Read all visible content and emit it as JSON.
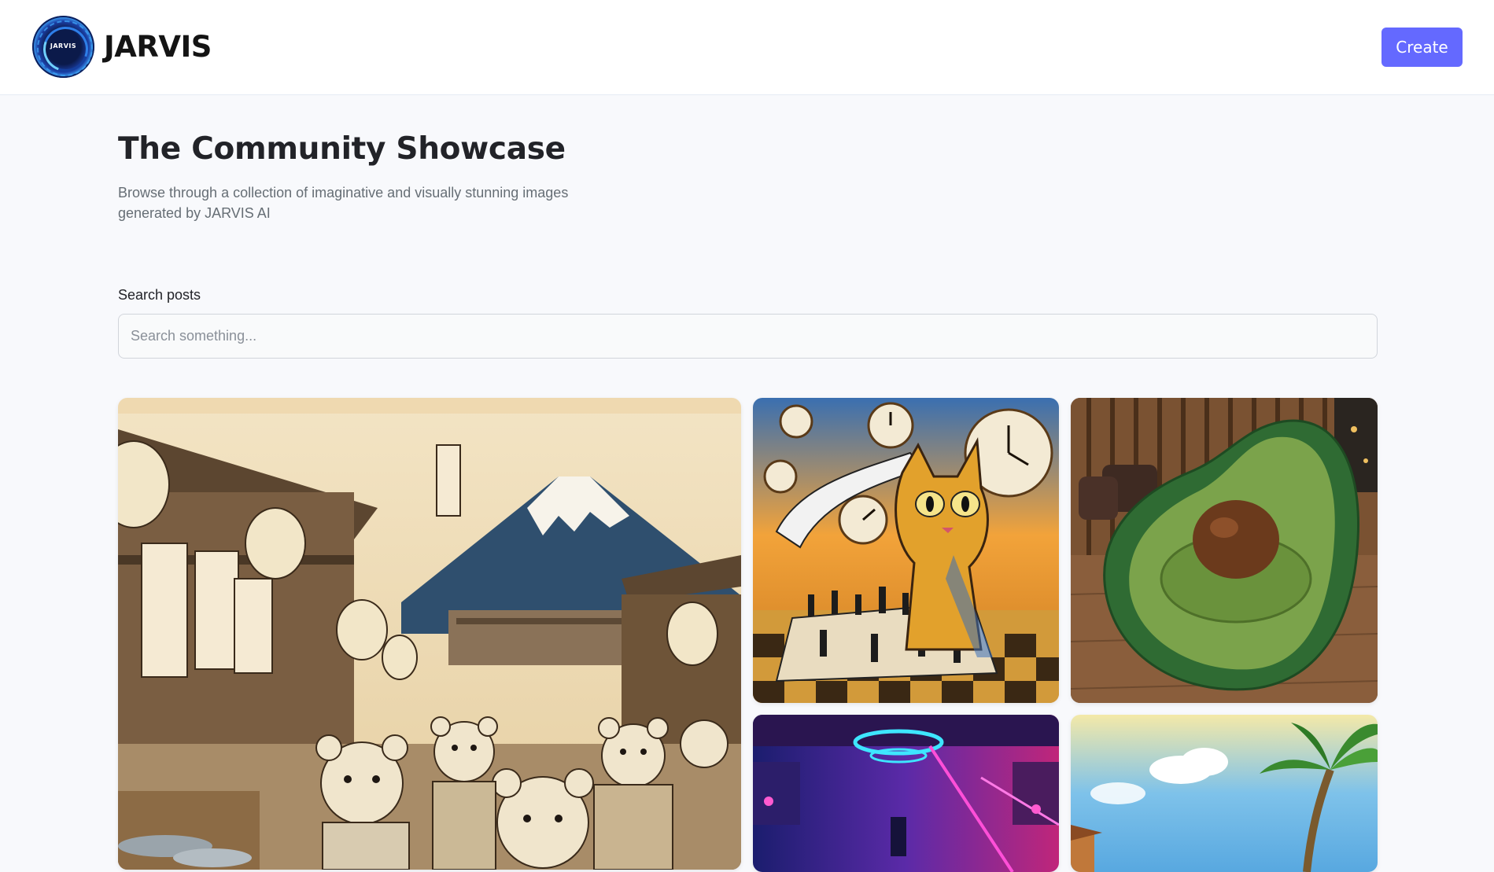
{
  "header": {
    "logo_badge_text": "JARVIS",
    "brand_name": "JARVIS",
    "create_label": "Create"
  },
  "main": {
    "title": "The Community Showcase",
    "subtitle": "Browse through a collection of imaginative and visually stunning images generated by JARVIS AI"
  },
  "search": {
    "label": "Search posts",
    "placeholder": "Search something...",
    "value": ""
  },
  "gallery": {
    "cards": [
      {
        "subject": "ukiyo-e bears market mount fuji"
      },
      {
        "subject": "surreal cat chess melting clocks"
      },
      {
        "subject": "avocado armchair"
      },
      {
        "subject": "neon cyberpunk corridor"
      },
      {
        "subject": "tropical beach palm tree"
      }
    ]
  },
  "colors": {
    "accent": "#6469ff",
    "page_bg": "#f8f9fc",
    "header_bg": "#ffffff",
    "title": "#222328",
    "subtitle": "#666e75"
  }
}
